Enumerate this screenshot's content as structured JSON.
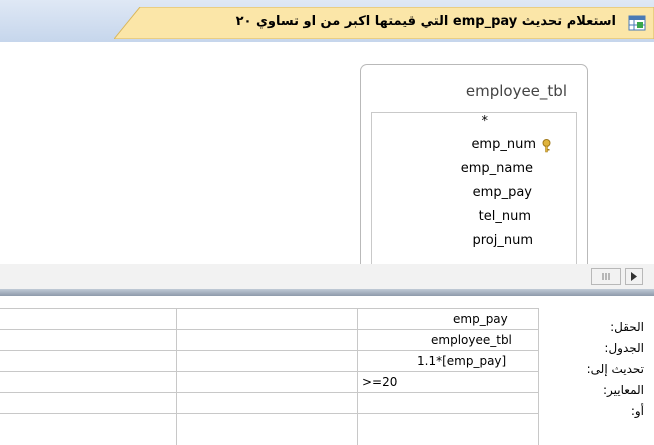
{
  "tab": {
    "title": "استعلام تحديث emp_pay  التي قيمتها اكبر من او تساوي ٢٠"
  },
  "table": {
    "name": "employee_tbl",
    "fields": [
      "*",
      "emp_num",
      "emp_name",
      "emp_pay",
      "tel_num",
      "proj_num"
    ]
  },
  "grid": {
    "row_labels": [
      "الحقل:",
      "الجدول:",
      "تحديث إلى:",
      "المعايير:",
      "أو:"
    ],
    "column1": {
      "field": "emp_pay",
      "table": "employee_tbl",
      "update_to": "1.1*[emp_pay]",
      "criteria": ">=20",
      "or": ""
    }
  }
}
